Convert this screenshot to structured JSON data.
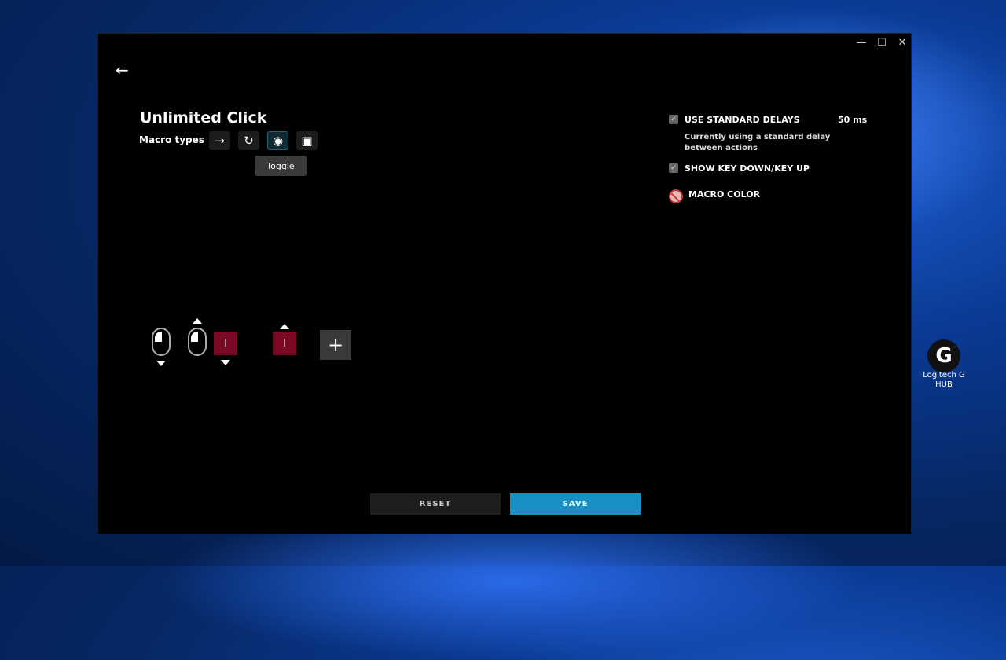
{
  "window": {
    "minimize": "—",
    "maximize": "☐",
    "close": "✕"
  },
  "page": {
    "title": "Unlimited Click",
    "macro_types_label": "Macro types",
    "tooltip": "Toggle"
  },
  "macro_types": [
    {
      "name": "no-repeat",
      "glyph": "→"
    },
    {
      "name": "repeat-while-holding",
      "glyph": "↻"
    },
    {
      "name": "toggle",
      "glyph": "◉"
    },
    {
      "name": "sequence",
      "glyph": "▣"
    }
  ],
  "settings": {
    "use_standard_delays": "USE STANDARD DELAYS",
    "delay_value": "50 ms",
    "delay_desc": "Currently using a standard delay between actions",
    "show_key_down_up": "SHOW KEY DOWN/KEY UP",
    "macro_color": "MACRO COLOR",
    "check": "✔"
  },
  "sequence": {
    "key1": "I",
    "key2": "I",
    "add": "+"
  },
  "buttons": {
    "reset": "RESET",
    "save": "SAVE"
  },
  "desktop": {
    "icon_label": "Logitech G HUB",
    "icon_glyph": "G"
  },
  "colors": {
    "save": "#1a8fc4",
    "key": "#7a0a24"
  }
}
